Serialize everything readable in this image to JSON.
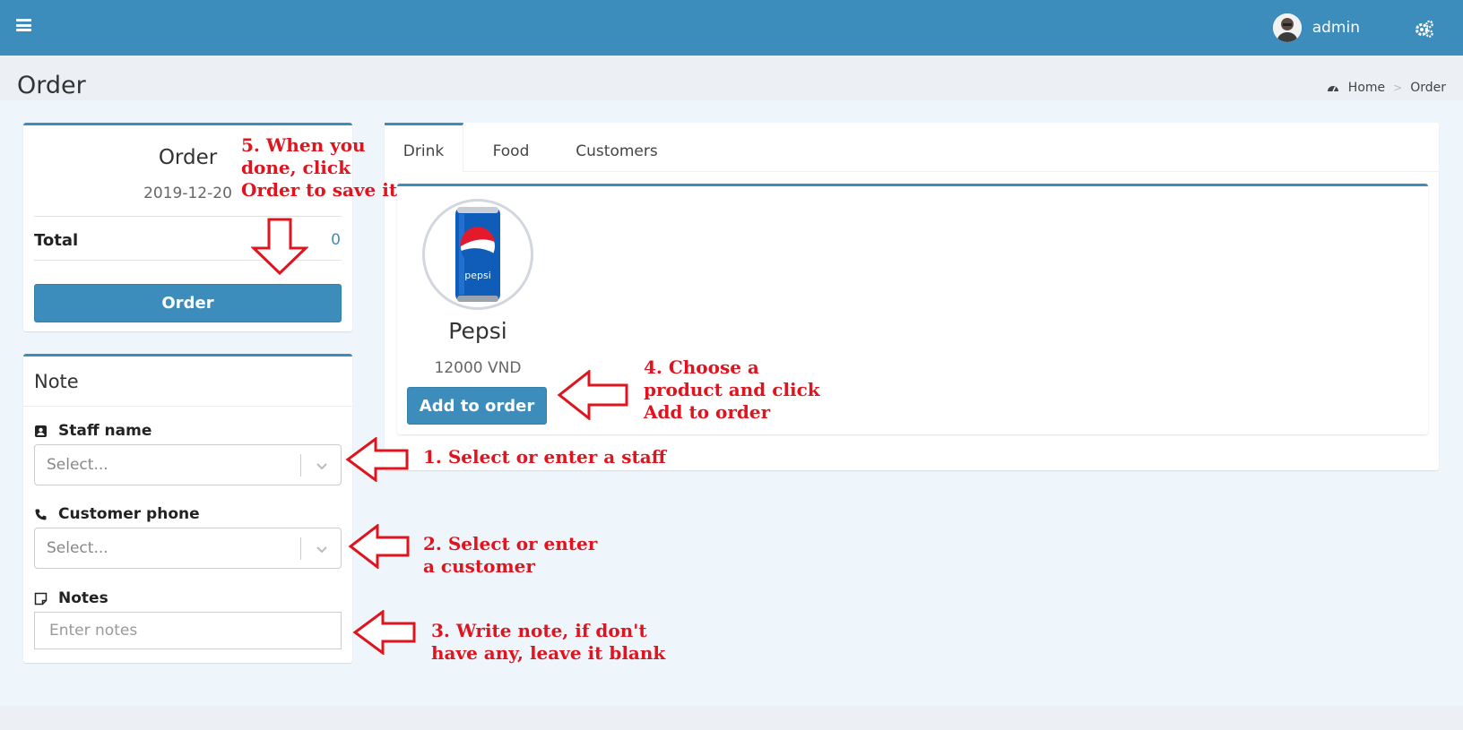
{
  "header": {
    "username": "admin",
    "menu_icon": "hamburger-icon",
    "settings_icon": "gears-icon"
  },
  "page": {
    "title": "Order",
    "breadcrumb": {
      "home": "Home",
      "current": "Order"
    }
  },
  "order_box": {
    "title": "Order",
    "date": "2019-12-20",
    "total_label": "Total",
    "total_value": "0",
    "order_button": "Order"
  },
  "note_box": {
    "title": "Note",
    "staff_label": "Staff name",
    "staff_placeholder": "Select...",
    "phone_label": "Customer phone",
    "phone_placeholder": "Select...",
    "notes_label": "Notes",
    "notes_placeholder": "Enter notes"
  },
  "tabs": [
    {
      "label": "Drink",
      "active": true
    },
    {
      "label": "Food",
      "active": false
    },
    {
      "label": "Customers",
      "active": false
    }
  ],
  "product": {
    "name": "Pepsi",
    "price": "12000 VND",
    "add_button": "Add to order"
  },
  "annotations": {
    "step1": "1. Select or enter a staff",
    "step2": "2. Select or enter\na customer",
    "step3": "3. Write note, if don't\nhave any, leave it blank",
    "step4": "4. Choose a\nproduct and click\nAdd to order",
    "step5": "5. When you\ndone, click\nOrder to save it"
  },
  "colors": {
    "primary": "#3c8dbc",
    "annotation": "#e0141e",
    "background": "#ecf0f5"
  }
}
